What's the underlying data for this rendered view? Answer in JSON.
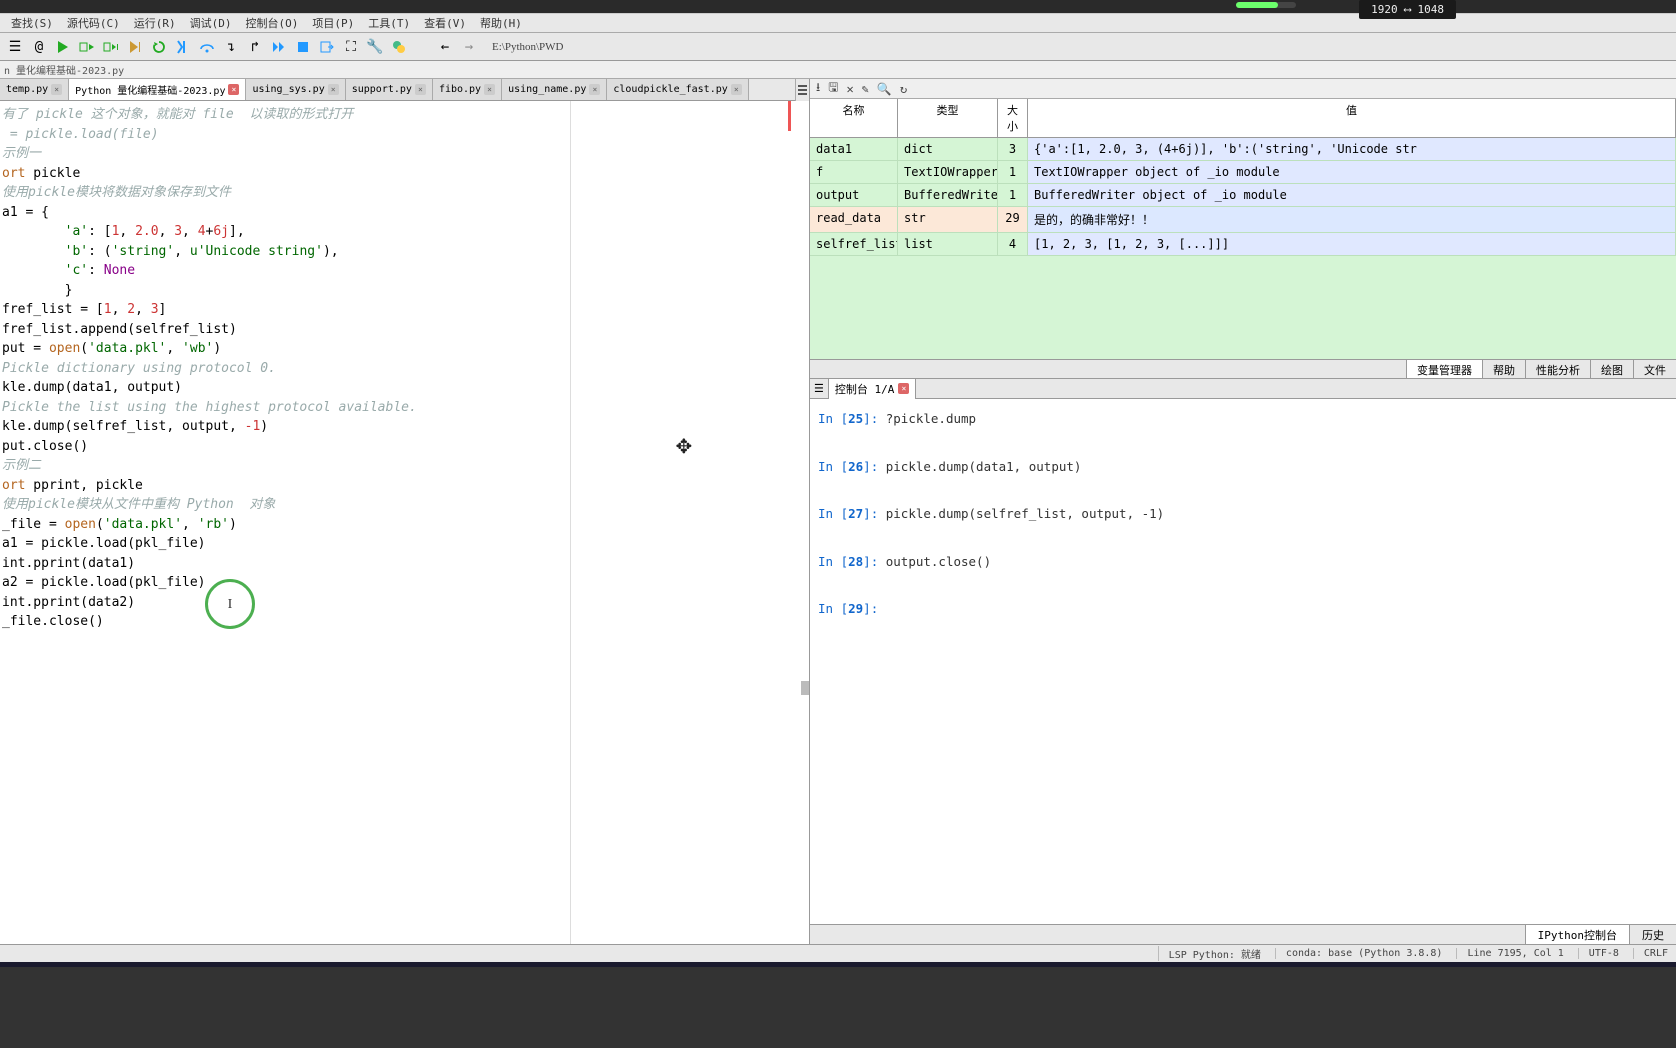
{
  "resolution": "1920 ⟷ 1048",
  "menu": [
    "查找(S)",
    "源代码(C)",
    "运行(R)",
    "调试(D)",
    "控制台(O)",
    "项目(P)",
    "工具(T)",
    "查看(V)",
    "帮助(H)"
  ],
  "path": "E:\\Python\\PWD",
  "breadcrumb": "n 量化编程基础-2023.py",
  "tabs": [
    {
      "label": "temp.py",
      "mod": false
    },
    {
      "label": "Python 量化编程基础-2023.py",
      "mod": true,
      "active": true
    },
    {
      "label": "using_sys.py",
      "mod": false
    },
    {
      "label": "support.py",
      "mod": false
    },
    {
      "label": "fibo.py",
      "mod": false
    },
    {
      "label": "using_name.py",
      "mod": false
    },
    {
      "label": "cloudpickle_fast.py",
      "mod": false
    }
  ],
  "code": [
    {
      "t": "有了 pickle 这个对象，就能对 file  以读取的形式打开",
      "cls": "cm"
    },
    {
      "t": " = pickle.load(file)",
      "cls": "cm"
    },
    {
      "t": ""
    },
    {
      "t": ""
    },
    {
      "t": "示例一",
      "cls": "cm"
    },
    {
      "t": ""
    },
    {
      "t": "<kw>ort</kw> pickle"
    },
    {
      "t": ""
    },
    {
      "t": "使用pickle模块将数据对象保存到文件",
      "cls": "cm"
    },
    {
      "t": "a1 = {"
    },
    {
      "t": "        <st>'a'</st>: [<nm>1</nm>, <nm>2.0</nm>, <nm>3</nm>, <nm>4</nm>+<nm>6j</nm>],"
    },
    {
      "t": "        <st>'b'</st>: (<st>'string'</st>, <st>u'Unicode string'</st>),"
    },
    {
      "t": "        <st>'c'</st>: <bl>None</bl>"
    },
    {
      "t": "        }"
    },
    {
      "t": ""
    },
    {
      "t": "fref_list = [<nm>1</nm>, <nm>2</nm>, <nm>3</nm>]"
    },
    {
      "t": "fref_list.append(selfref_list)"
    },
    {
      "t": ""
    },
    {
      "t": "put = <kw>open</kw>(<st>'data.pkl'</st>, <st>'wb'</st>)"
    },
    {
      "t": ""
    },
    {
      "t": "Pickle dictionary using protocol 0.",
      "cls": "cm"
    },
    {
      "t": "kle.dump(data1, output)"
    },
    {
      "t": ""
    },
    {
      "t": "Pickle the list using the highest protocol available.",
      "cls": "cm"
    },
    {
      "t": "kle.dump(selfref_list, output, <nm>-1</nm>)"
    },
    {
      "t": ""
    },
    {
      "t": "put.close()"
    },
    {
      "t": ""
    },
    {
      "t": "",
      "hl": true
    },
    {
      "t": ""
    },
    {
      "t": "示例二",
      "cls": "cm"
    },
    {
      "t": ""
    },
    {
      "t": "<kw>ort</kw> pprint, pickle"
    },
    {
      "t": ""
    },
    {
      "t": "使用pickle模块从文件中重构 Python  对象",
      "cls": "cm"
    },
    {
      "t": "_file = <kw>open</kw>(<st>'data.pkl'</st>, <st>'rb'</st>)"
    },
    {
      "t": ""
    },
    {
      "t": "a1 = pickle.load(pkl_file)"
    },
    {
      "t": "int.pprint(data1)"
    },
    {
      "t": ""
    },
    {
      "t": "a2 = pickle.load(pkl_file)"
    },
    {
      "t": "int.pprint(data2)"
    },
    {
      "t": ""
    },
    {
      "t": "_file.close()"
    }
  ],
  "var_hdr": [
    "名称",
    "类型",
    "大小",
    "值"
  ],
  "vars": [
    {
      "n": "data1",
      "t": "dict",
      "s": "3",
      "v": "{'a':[1, 2.0, 3, (4+6j)], 'b':('string', 'Unicode str"
    },
    {
      "n": "f",
      "t": "TextIOWrapper",
      "s": "1",
      "v": "TextIOWrapper object of _io module"
    },
    {
      "n": "output",
      "t": "BufferedWriter",
      "s": "1",
      "v": "BufferedWriter object of _io module"
    },
    {
      "n": "read_data",
      "t": "str",
      "s": "29",
      "v": "是的，的确非常好！！",
      "pink": true
    },
    {
      "n": "selfref_list",
      "t": "list",
      "s": "4",
      "v": "[1, 2, 3, [1, 2, 3, [...]]]"
    }
  ],
  "right_tabs": [
    "变量管理器",
    "帮助",
    "性能分析",
    "绘图",
    "文件"
  ],
  "con_tab": "控制台 1/A",
  "console": [
    {
      "n": "25",
      "c": "?pickle.dump"
    },
    {
      "n": "26",
      "c": "pickle.dump(data1, output)"
    },
    {
      "n": "27",
      "c": "pickle.dump(selfref_list, output, -1)"
    },
    {
      "n": "28",
      "c": "output.close()"
    },
    {
      "n": "29",
      "c": ""
    }
  ],
  "bot_tabs": [
    "IPython控制台",
    "历史"
  ],
  "status": {
    "lsp": "LSP Python: 就绪",
    "conda": "conda: base (Python 3.8.8)",
    "line": "Line 7195, Col 1",
    "enc": "UTF-8",
    "eol": "CRLF"
  }
}
